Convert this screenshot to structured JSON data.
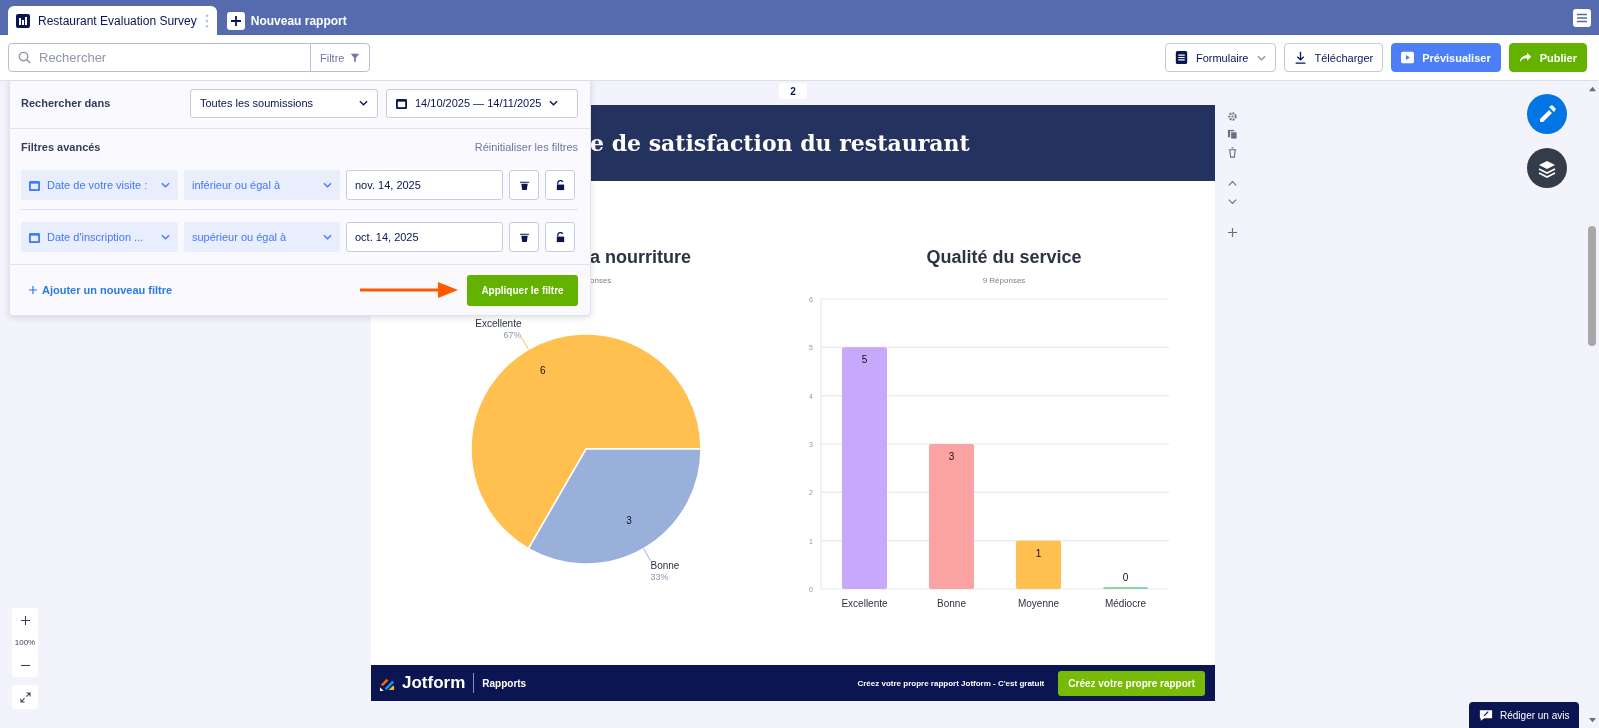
{
  "tabs": [
    {
      "label": "Restaurant Evaluation Survey",
      "selected": true
    }
  ],
  "new_report_button": "Nouveau rapport",
  "toolbar": {
    "search": {
      "placeholder": "Rechercher"
    },
    "filter_button": "Filtre",
    "form_dropdown": "Formulaire",
    "download_button": "Télécharger",
    "preview_button": "Prévisualiser",
    "publish_button": "Publier"
  },
  "filter_panel": {
    "search_in_label": "Rechercher dans",
    "scope": "Toutes les soumissions",
    "date_range": "14/10/2025 — 14/11/2025",
    "advanced_label": "Filtres avancés",
    "reset_link": "Réinitialiser les filtres",
    "filters": [
      {
        "field": "Date de votre visite :",
        "operator": "inférieur ou égal à",
        "value": "nov. 14, 2025"
      },
      {
        "field": "Date d'inscription ...",
        "operator": "supérieur ou égal à",
        "value": "oct. 14, 2025"
      }
    ],
    "add_filter_link": "Ajouter un nouveau filtre",
    "apply_button": "Appliquer le filtre"
  },
  "page_number": "2",
  "report": {
    "title": "e de satisfaction du restaurant",
    "food_chart": {
      "title": "a nourriture",
      "subtitle": "onses",
      "slices": [
        {
          "color": "#ffc04f",
          "percent_label": "67%"
        },
        {
          "color": "#98b0da",
          "percent_label": "33%"
        }
      ],
      "chart_data": {
        "type": "pie",
        "categories": [
          "Excellente",
          "Bonne"
        ],
        "values": [
          6,
          3
        ],
        "data_labels": true
      }
    },
    "service_chart": {
      "title": "Qualité du service",
      "subtitle": "9 Réponses",
      "bars": [
        {
          "color": "#c6a9fb"
        },
        {
          "color": "#fba3a3"
        },
        {
          "color": "#ffc04f"
        },
        {
          "color": "#8bd6a6"
        }
      ],
      "chart_data": {
        "type": "bar",
        "categories": [
          "Excellente",
          "Bonne",
          "Moyenne",
          "Médiocre"
        ],
        "values": [
          5,
          3,
          1,
          0
        ],
        "ylim": [
          0,
          6
        ],
        "yticks": [
          0,
          1,
          2,
          3,
          4,
          5,
          6
        ],
        "grid": true,
        "data_labels": true
      }
    }
  },
  "footer": {
    "brand": "Jotform",
    "section": "Rapports",
    "promo": "Créez votre propre rapport Jotform - C'est gratuit",
    "cta_button": "Créez votre propre rapport"
  },
  "zoom_level": "100%",
  "review_button": "Rédiger un avis"
}
